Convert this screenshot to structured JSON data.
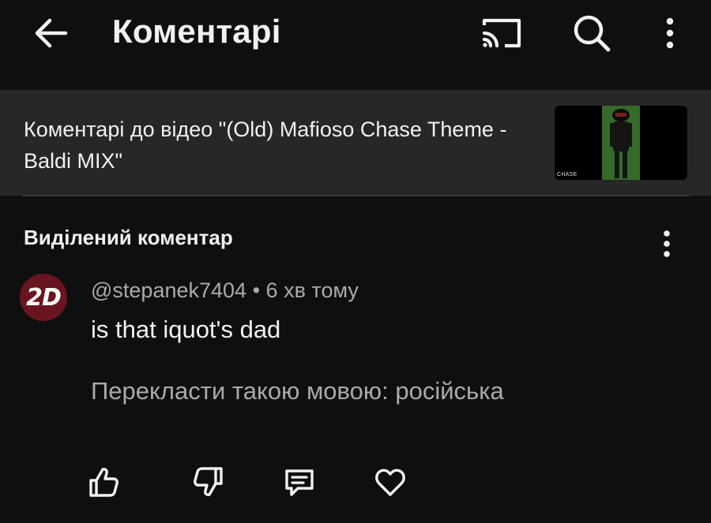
{
  "header": {
    "title": "Коментарі",
    "icons": [
      "back-arrow-icon",
      "cast-icon",
      "search-icon",
      "more-vert-icon"
    ]
  },
  "video_banner": {
    "text": "Коментарі до відео \"(Old) Mafioso Chase Theme - Baldi MIX\"",
    "thumbnail_caption": "CHASE"
  },
  "highlighted": {
    "section_title": "Виділений коментар",
    "comment": {
      "avatar_text": "2D",
      "author": "@stepanek7404",
      "separator": "•",
      "time": "6 хв тому",
      "text": "is that iquot's dad",
      "translate_label": "Перекласти такою мовою: російська"
    },
    "actions": [
      "like-icon",
      "dislike-icon",
      "reply-icon",
      "heart-icon"
    ]
  },
  "colors": {
    "background": "#0f0f0f",
    "banner": "#272727",
    "primary_text": "#f1f1f1",
    "secondary_text": "#aaaaaa",
    "avatar_bg": "#6a1420"
  }
}
